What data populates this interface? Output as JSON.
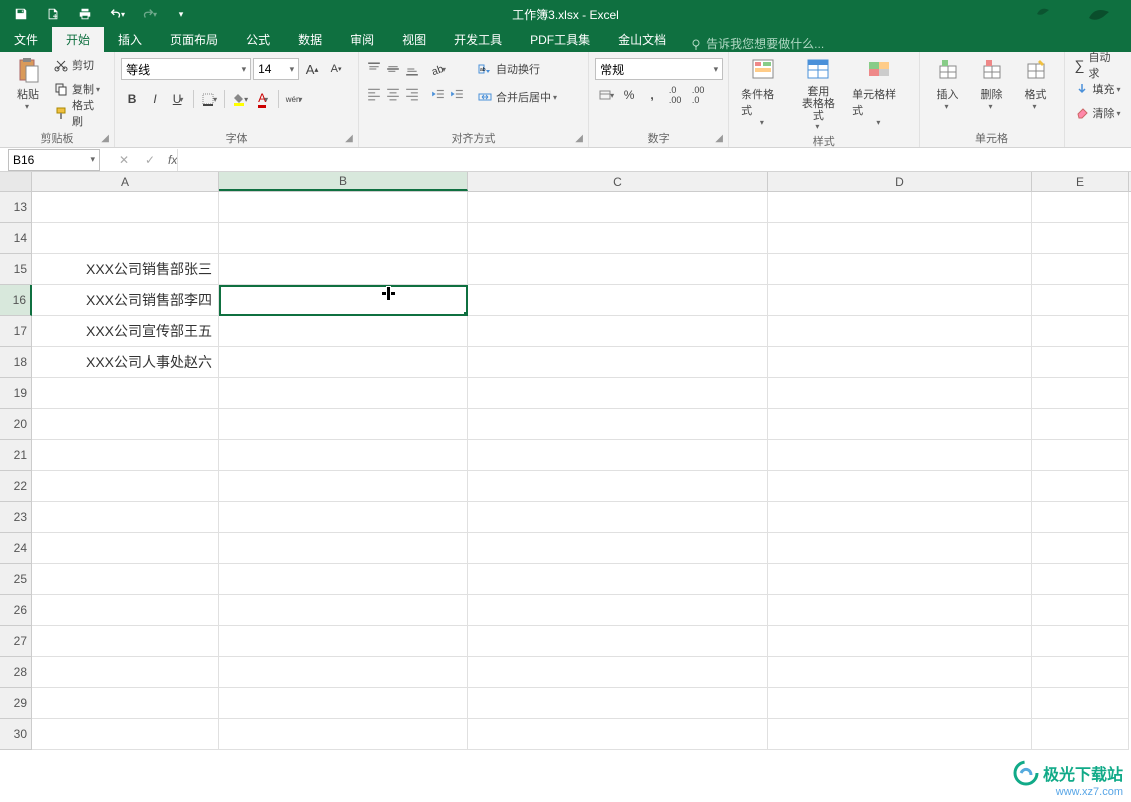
{
  "app": {
    "title": "工作簿3.xlsx - Excel"
  },
  "tabs": {
    "file": "文件",
    "home": "开始",
    "insert": "插入",
    "layout": "页面布局",
    "formula": "公式",
    "data": "数据",
    "review": "审阅",
    "view": "视图",
    "dev": "开发工具",
    "pdf": "PDF工具集",
    "jinshan": "金山文档"
  },
  "tellme": "告诉我您想要做什么...",
  "clipboard": {
    "paste": "粘贴",
    "cut": "剪切",
    "copy": "复制",
    "format_painter": "格式刷",
    "group": "剪贴板"
  },
  "font": {
    "name": "等线",
    "size": "14",
    "group": "字体",
    "ruby_hint": "wén"
  },
  "alignment": {
    "wrap": "自动换行",
    "merge": "合并后居中",
    "group": "对齐方式"
  },
  "number": {
    "format": "常规",
    "group": "数字"
  },
  "styles": {
    "cond": "条件格式",
    "table": "套用\n表格格式",
    "cell": "单元格样式",
    "group": "样式"
  },
  "cells": {
    "insert": "插入",
    "delete": "删除",
    "format": "格式",
    "group": "单元格"
  },
  "editing": {
    "autosum": "自动求",
    "fill": "填充",
    "clear": "清除"
  },
  "namebox": "B16",
  "columns": [
    "A",
    "B",
    "C",
    "D",
    "E"
  ],
  "rows": [
    13,
    14,
    15,
    16,
    17,
    18,
    19,
    20,
    21,
    22,
    23,
    24,
    25,
    26,
    27,
    28,
    29,
    30
  ],
  "cells_data": {
    "A15": "XXX公司销售部张三",
    "A16": "XXX公司销售部李四",
    "A17": "XXX公司宣传部王五",
    "A18": "XXX公司人事处赵六"
  },
  "selected": {
    "row": 16,
    "col": "B"
  },
  "watermark": {
    "name": "极光下载站",
    "url": "www.xz7.com"
  }
}
